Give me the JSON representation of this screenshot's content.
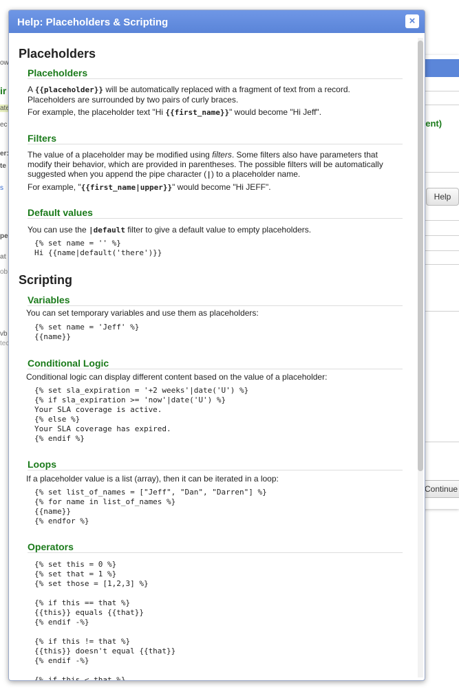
{
  "background": {
    "left_fragments": [
      "ow",
      "ir",
      "ate",
      "ec",
      "er:",
      "te",
      "s",
      "pe",
      "at",
      "ob",
      "vb",
      "tec"
    ],
    "right_panel": {
      "event_text": "vent)",
      "help_button": "Help",
      "continue_button": "Continue"
    }
  },
  "dialog": {
    "title": "Help: Placeholders & Scripting",
    "close_label": "×"
  },
  "placeholders_section": {
    "title": "Placeholders",
    "placeholders": {
      "heading": "Placeholders",
      "p1_pre": "A ",
      "p1_code": "{{placeholder}}",
      "p1_post": " will be automatically replaced with a fragment of text from a record. Placeholders are surrounded by two pairs of curly braces.",
      "p2_pre": "For example, the placeholder text \"Hi ",
      "p2_code": "{{first_name}}",
      "p2_post": "\" would become \"Hi Jeff\"."
    },
    "filters": {
      "heading": "Filters",
      "p1_pre": "The value of a placeholder may be modified using ",
      "p1_em": "filters",
      "p1_post": ". Some filters also have parameters that modify their behavior, which are provided in parentheses. The possible filters will be automatically suggested when you append the pipe character (",
      "p1_code": "|",
      "p1_end": ") to a placeholder name.",
      "p2_pre": "For example, \"",
      "p2_code": "{{first_name|upper}}",
      "p2_post": "\" would become \"Hi JEFF\"."
    },
    "default_values": {
      "heading": "Default values",
      "p1_pre": "You can use the ",
      "p1_code": "|default",
      "p1_post": " filter to give a default value to empty placeholders.",
      "code": "{% set name = '' %}\nHi {{name|default('there')}}"
    }
  },
  "scripting_section": {
    "title": "Scripting",
    "variables": {
      "heading": "Variables",
      "text": "You can set temporary variables and use them as placeholders:",
      "code": "{% set name = 'Jeff' %}\n{{name}}"
    },
    "conditional_logic": {
      "heading": "Conditional Logic",
      "text": "Conditional logic can display different content based on the value of a placeholder:",
      "code": "{% set sla_expiration = '+2 weeks'|date('U') %}\n{% if sla_expiration >= 'now'|date('U') %}\nYour SLA coverage is active.\n{% else %}\nYour SLA coverage has expired.\n{% endif %}"
    },
    "loops": {
      "heading": "Loops",
      "text": "If a placeholder value is a list (array), then it can be iterated in a loop:",
      "code": "{% set list_of_names = [\"Jeff\", \"Dan\", \"Darren\"] %}\n{% for name in list_of_names %}\n{{name}}\n{% endfor %}"
    },
    "operators": {
      "heading": "Operators",
      "code": "{% set this = 0 %}\n{% set that = 1 %}\n{% set those = [1,2,3] %}\n\n{% if this == that %}\n{{this}} equals {{that}}\n{% endif -%}\n\n{% if this != that %}\n{{this}} doesn't equal {{that}}\n{% endif -%}\n\n{% if this < that %}"
    }
  }
}
